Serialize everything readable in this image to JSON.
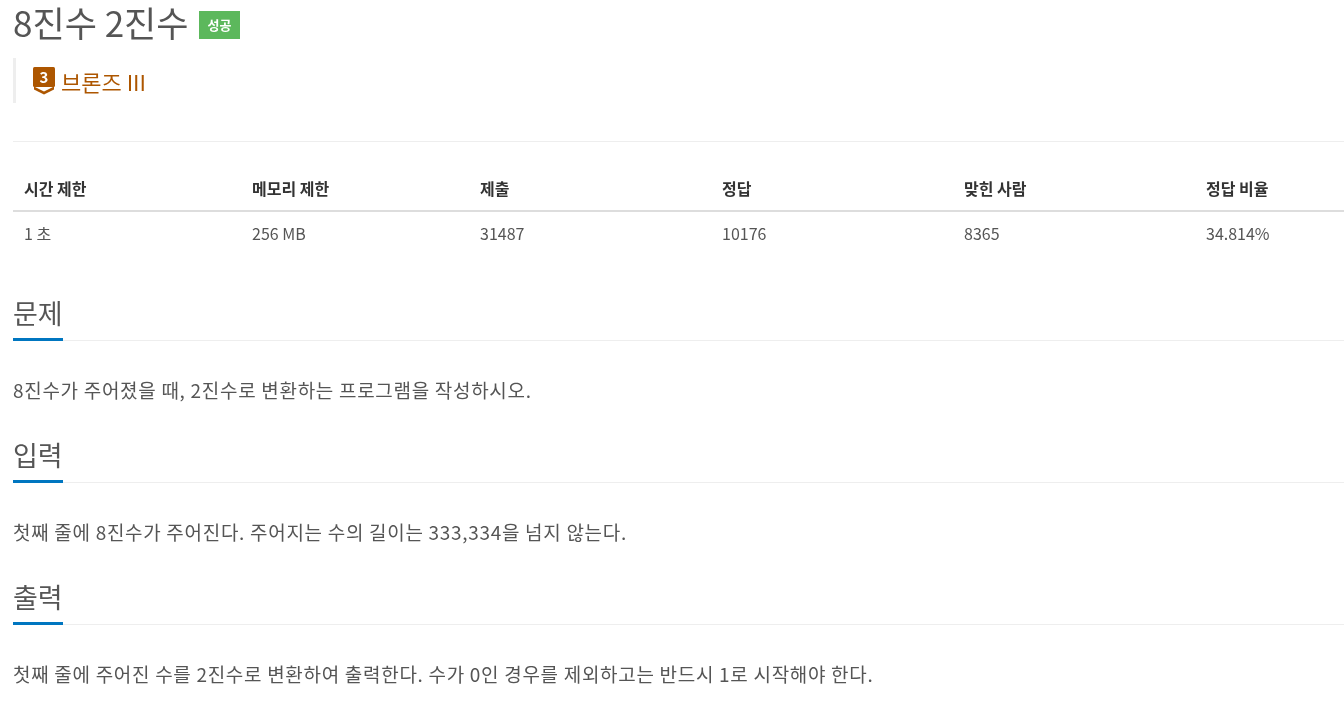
{
  "problem": {
    "title": "8진수 2진수",
    "result_badge": {
      "label": "성공",
      "kind": "success"
    },
    "tier": {
      "level": "3",
      "name": "브론즈 III",
      "kind": "bronze"
    }
  },
  "info_table": {
    "columns": [
      "시간 제한",
      "메모리 제한",
      "제출",
      "정답",
      "맞힌 사람",
      "정답 비율"
    ],
    "rows": [
      [
        "1 초",
        "256 MB",
        "31487",
        "10176",
        "8365",
        "34.814%"
      ]
    ]
  },
  "sections": [
    {
      "heading": "문제",
      "body": "8진수가 주어졌을 때, 2진수로 변환하는 프로그램을 작성하시오."
    },
    {
      "heading": "입력",
      "body": "첫째 줄에 8진수가 주어진다. 주어지는 수의 길이는 333,334을 넘지 않는다."
    },
    {
      "heading": "출력",
      "body": "첫째 줄에 주어진 수를 2진수로 변환하여 출력한다. 수가 0인 경우를 제외하고는 반드시 1로 시작해야 한다."
    }
  ]
}
